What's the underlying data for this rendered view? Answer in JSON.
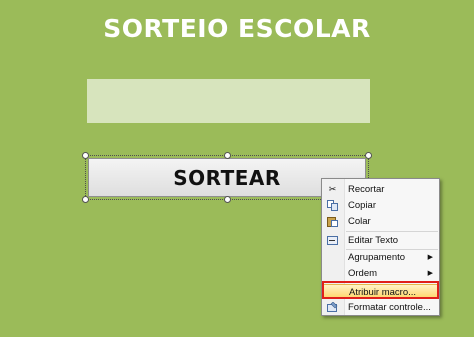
{
  "title": "SORTEIO ESCOLAR",
  "result_box": {
    "value": ""
  },
  "button": {
    "label": "SORTEAR"
  },
  "context_menu": {
    "items": [
      {
        "label": "Recortar",
        "icon": "scissors-icon"
      },
      {
        "label": "Copiar",
        "icon": "copy-icon"
      },
      {
        "label": "Colar",
        "icon": "paste-icon"
      },
      {
        "label": "Editar Texto",
        "icon": "edit-text-icon"
      },
      {
        "label": "Agrupamento",
        "submenu": true
      },
      {
        "label": "Ordem",
        "submenu": true
      },
      {
        "label": "Atribuir macro...",
        "highlighted": true
      },
      {
        "label": "Formatar controle...",
        "icon": "format-control-icon"
      }
    ]
  },
  "colors": {
    "background": "#9bbb59",
    "result_box": "#d7e4bd",
    "highlight_border": "#e0201b"
  }
}
